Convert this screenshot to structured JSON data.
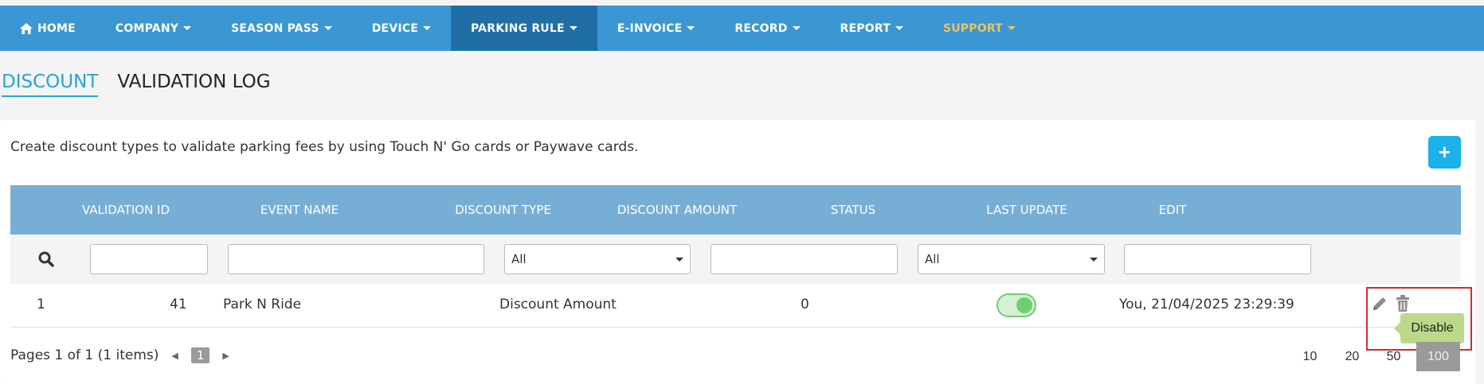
{
  "nav": {
    "items": [
      {
        "label": "HOME",
        "icon": "home-icon"
      },
      {
        "label": "COMPANY"
      },
      {
        "label": "SEASON PASS"
      },
      {
        "label": "DEVICE"
      },
      {
        "label": "PARKING RULE"
      },
      {
        "label": "E-INVOICE"
      },
      {
        "label": "RECORD"
      },
      {
        "label": "REPORT"
      },
      {
        "label": "SUPPORT"
      }
    ],
    "active": "PARKING RULE",
    "bg_color": "#3a97d4",
    "active_color": "#1f6fa6",
    "support_color": "#f3c15c"
  },
  "tabs": [
    "DISCOUNT",
    "VALIDATION LOG"
  ],
  "description": "Create discount types to validate parking fees by using Touch N' Go cards or Paywave cards.",
  "add_button": {
    "label": "+"
  },
  "table": {
    "headers": [
      "VALIDATION ID",
      "EVENT NAME",
      "DISCOUNT TYPE",
      "DISCOUNT AMOUNT",
      "STATUS",
      "LAST UPDATE",
      "EDIT"
    ],
    "filters": {
      "discount_type": "All",
      "status": "All"
    },
    "rows": [
      {
        "index": "1",
        "validation_id": "41",
        "event_name": "Park N Ride",
        "discount_type": "Discount Amount",
        "discount_amount": "0",
        "status_on": true,
        "last_update": "You, 21/04/2025 23:29:39"
      }
    ]
  },
  "tooltip": "Disable",
  "pager": {
    "summary": "Pages 1 of 1 (1 items)",
    "current_page": "1",
    "page_sizes": [
      "10",
      "20",
      "50",
      "100"
    ],
    "active_size": "100"
  }
}
